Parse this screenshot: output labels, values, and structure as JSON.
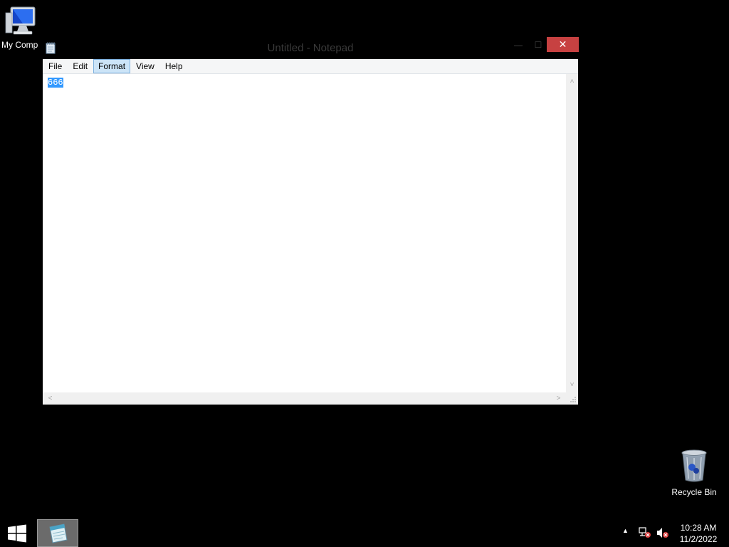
{
  "desktop": {
    "icons": [
      {
        "label": "My Comp",
        "icon": "computer-icon"
      },
      {
        "label": "Recycle Bin",
        "icon": "recycle-bin-icon"
      }
    ]
  },
  "notepad": {
    "title": "Untitled - Notepad",
    "menu": [
      "File",
      "Edit",
      "Format",
      "View",
      "Help"
    ],
    "active_menu": "Format",
    "content": "666",
    "selection_color": "#3399ff",
    "close_color": "#c74141"
  },
  "taskbar": {
    "time": "10:28 AM",
    "date": "11/2/2022"
  }
}
